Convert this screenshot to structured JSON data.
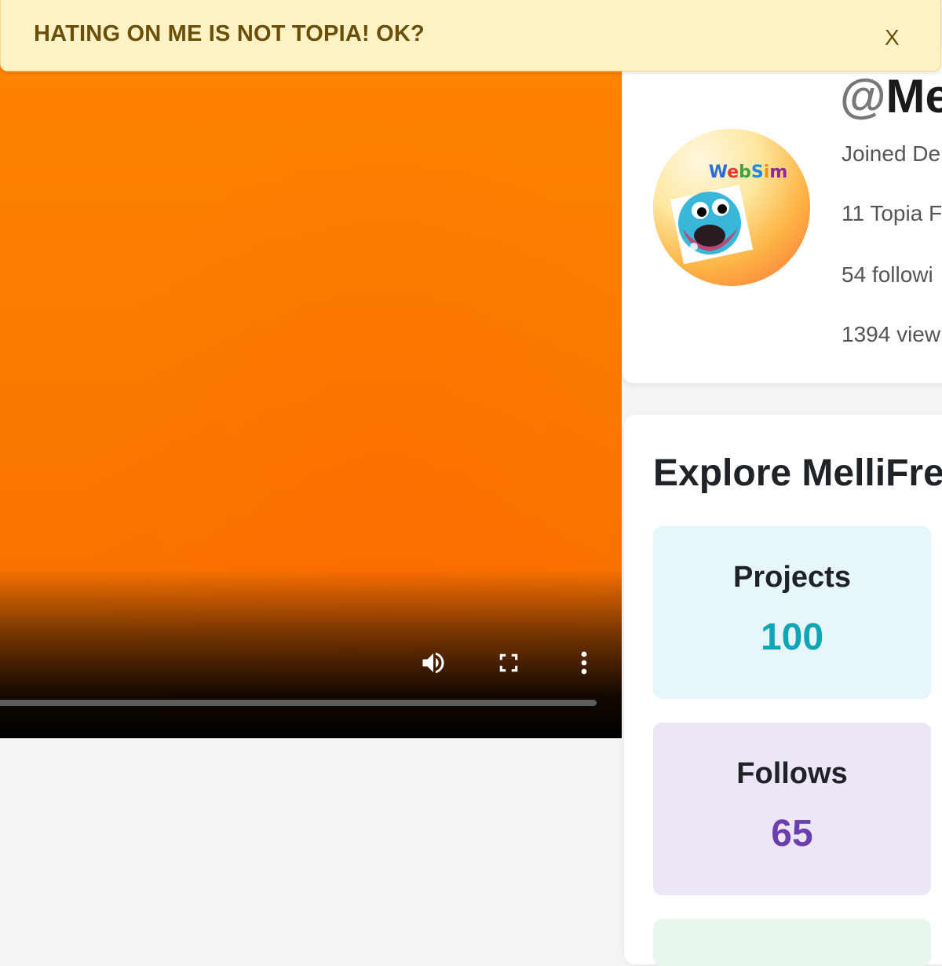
{
  "banner": {
    "message": "HATING ON ME IS NOT TOPIA! OK?",
    "close_label": "X"
  },
  "video": {
    "progress": 0
  },
  "profile": {
    "handle_prefix": "@",
    "handle": "Me",
    "avatar_text": "WebSim",
    "joined": "Joined De",
    "topia": "11 Topia F",
    "following": "54 followi",
    "views": "1394 view"
  },
  "explore": {
    "title": "Explore MelliFren",
    "tiles": [
      {
        "label": "Projects",
        "count": "100",
        "color": "#0ea5b7"
      },
      {
        "label": "Follows",
        "count": "65",
        "color": "#6b3fae"
      }
    ]
  },
  "colors": {
    "accent_orange": "#fb7c00",
    "banner_bg": "#fef3c7",
    "projects_bg": "#e6f6fb",
    "follows_bg": "#ece6f6"
  }
}
